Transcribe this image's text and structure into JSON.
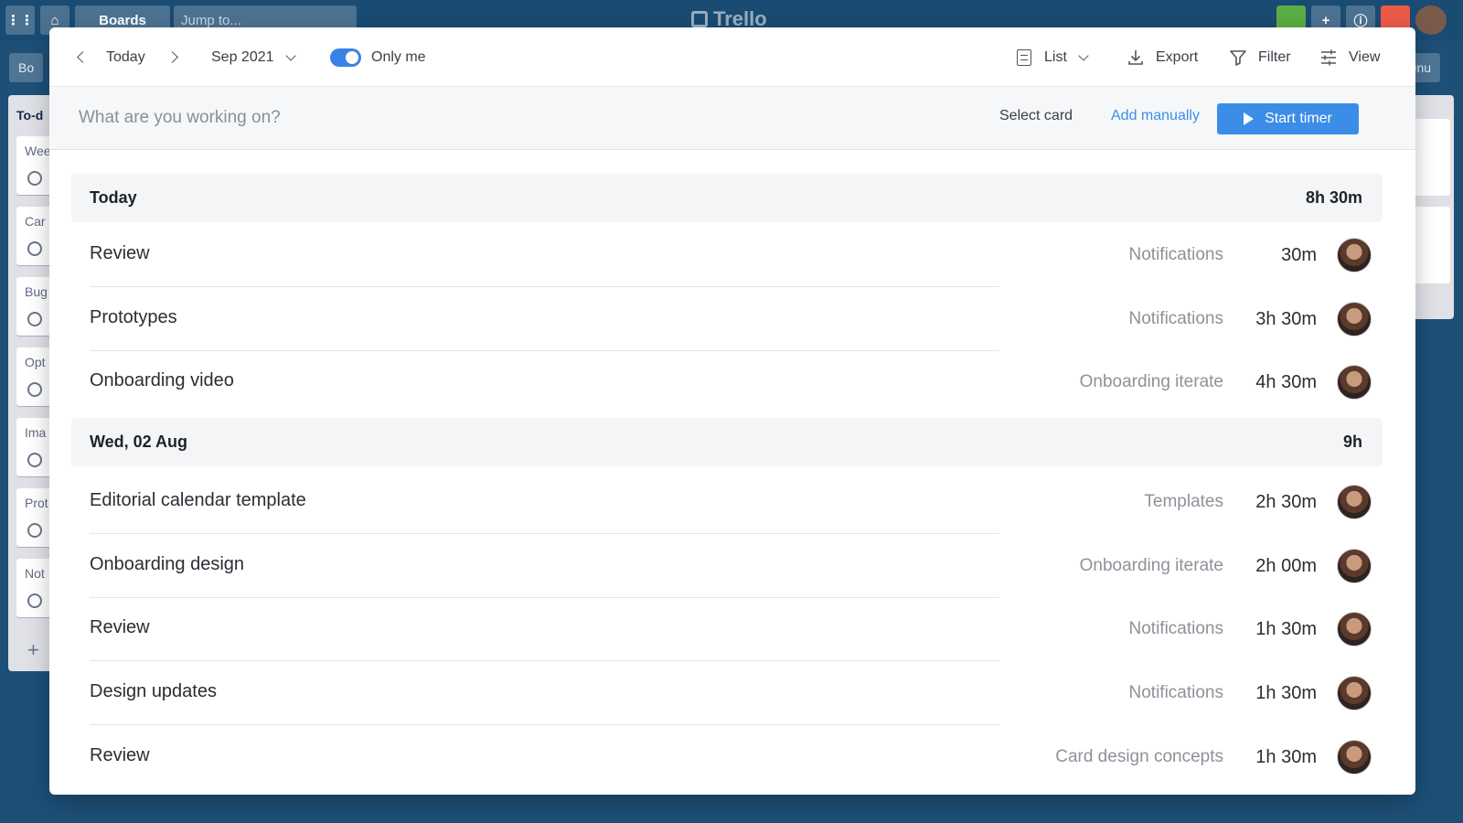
{
  "background": {
    "topbar": {
      "boards_label": "Boards",
      "jump_placeholder": "Jump to...",
      "logo_text": "Trello"
    },
    "board": {
      "left_header_label": "Bo",
      "right_header_label": "menu",
      "list_title": "To-d",
      "cards": [
        "Wee",
        "Car",
        "Bug",
        "Opt",
        "Ima",
        "Prot",
        "Not"
      ]
    }
  },
  "toolbar": {
    "today_label": "Today",
    "month_label": "Sep 2021",
    "only_me_label": "Only me",
    "only_me_on": true,
    "list_label": "List",
    "export_label": "Export",
    "filter_label": "Filter",
    "view_label": "View"
  },
  "timer": {
    "placeholder": "What are you working on?",
    "select_card_label": "Select card",
    "add_manually_label": "Add manually",
    "start_label": "Start timer"
  },
  "groups": [
    {
      "date": "Today",
      "total": "8h 30m",
      "entries": [
        {
          "title": "Review",
          "project": "Notifications",
          "duration": "30m"
        },
        {
          "title": "Prototypes",
          "project": "Notifications",
          "duration": "3h 30m"
        },
        {
          "title": "Onboarding video",
          "project": "Onboarding iterate",
          "duration": "4h 30m"
        }
      ]
    },
    {
      "date": "Wed, 02 Aug",
      "total": "9h",
      "entries": [
        {
          "title": "Editorial calendar template",
          "project": "Templates",
          "duration": "2h 30m"
        },
        {
          "title": "Onboarding design",
          "project": "Onboarding iterate",
          "duration": "2h 00m"
        },
        {
          "title": "Review",
          "project": "Notifications",
          "duration": "1h 30m"
        },
        {
          "title": "Design updates",
          "project": "Notifications",
          "duration": "1h 30m"
        },
        {
          "title": "Review",
          "project": "Card design concepts",
          "duration": "1h 30m"
        }
      ]
    }
  ],
  "colors": {
    "accent": "#3b8de8",
    "board_bg": "#1d4f77"
  }
}
